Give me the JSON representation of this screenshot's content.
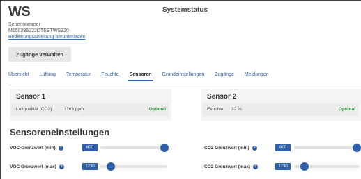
{
  "header": {
    "device": "WS",
    "page_title": "Systemstatus",
    "serial_label": "Seriennummer",
    "serial_value": "M150295222DTESTWS320",
    "manual_link": "Bedienungsanleitung herunterladen",
    "access_button": "Zugänge verwalten"
  },
  "tabs": [
    {
      "label": "Übersicht"
    },
    {
      "label": "Lüftung"
    },
    {
      "label": "Temperatur"
    },
    {
      "label": "Feuchte"
    },
    {
      "label": "Sensoren",
      "active": true
    },
    {
      "label": "Grundeinstellungen"
    },
    {
      "label": "Zugänge"
    },
    {
      "label": "Meldungen"
    }
  ],
  "sensor1": {
    "title": "Sensor 1",
    "label": "Luftqualität (CO2)",
    "value": "1163 ppm",
    "status": "Optimal"
  },
  "sensor2": {
    "title": "Sensor 2",
    "label": "Feuchte",
    "value": "32 %",
    "status": "Optimal"
  },
  "settings": {
    "title": "Sensoreneinstellungen",
    "voc_min": {
      "label": "VOC-Grenzwert (min)",
      "value": "800",
      "level": 0.96
    },
    "voc_max": {
      "label": "VOC Grenzwert (max)",
      "value": "1230",
      "level": 0.16
    },
    "co2_min": {
      "label": "CO2 Grenzwert (min)",
      "value": "800",
      "level": 0.96
    },
    "co2_max": {
      "label": "CO2 Grenzwert (max)",
      "value": "1230",
      "level": 0.16
    }
  },
  "colors": {
    "accent": "#2f5fa8",
    "status_ok": "#2e8b2e"
  },
  "icons": {
    "help": "question-circle-icon"
  }
}
